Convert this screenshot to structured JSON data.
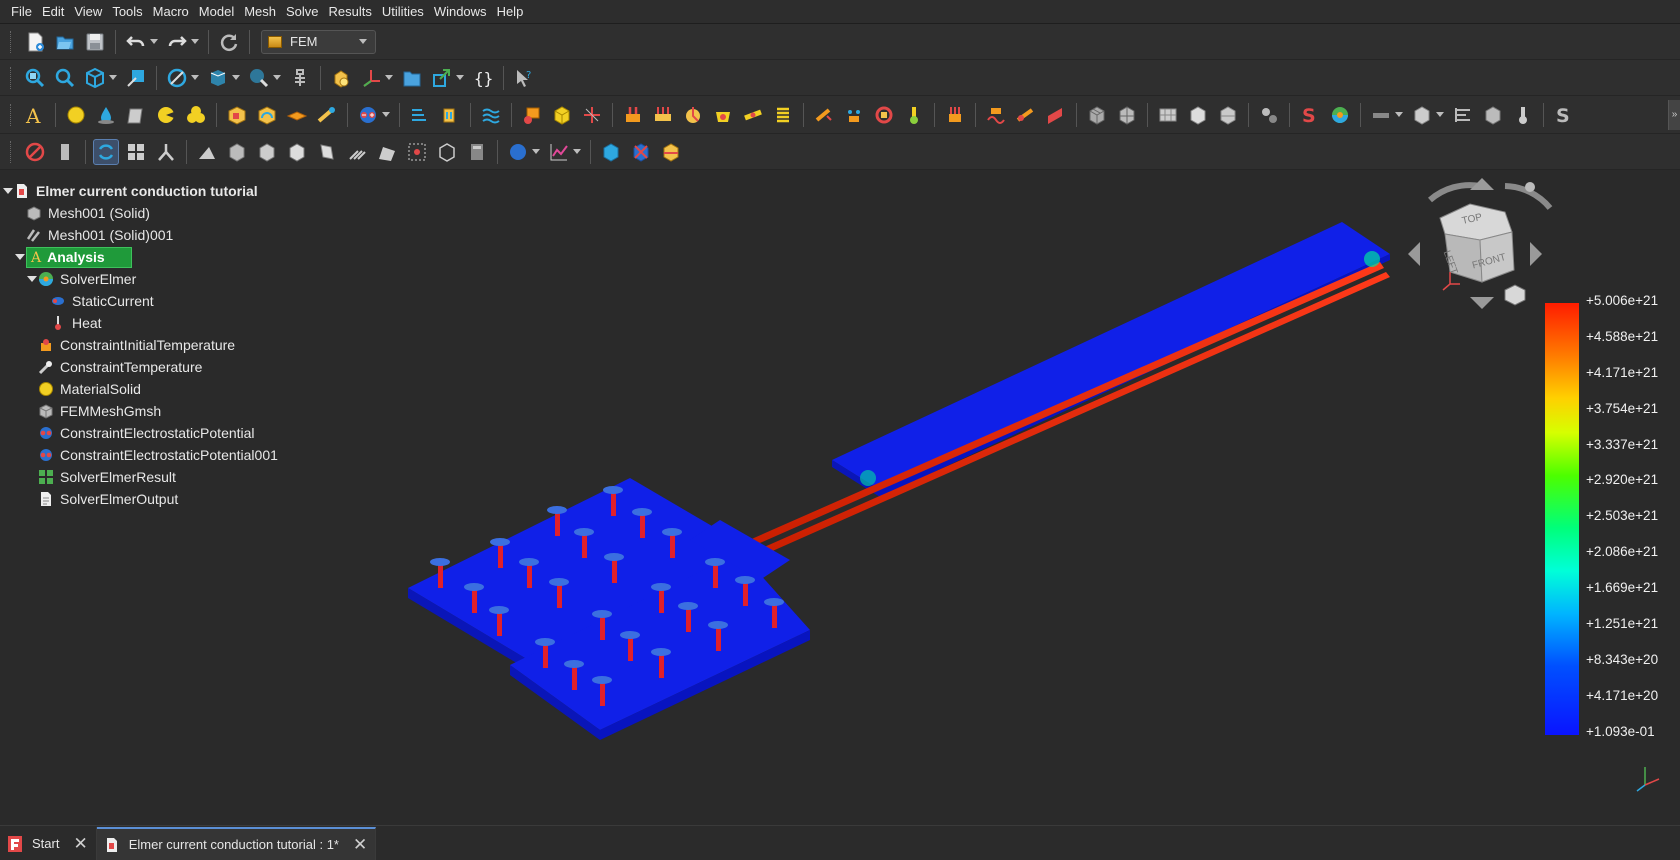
{
  "menu": [
    "File",
    "Edit",
    "View",
    "Tools",
    "Macro",
    "Model",
    "Mesh",
    "Solve",
    "Results",
    "Utilities",
    "Windows",
    "Help"
  ],
  "workbench": {
    "selected": "FEM"
  },
  "tree": {
    "root": "Elmer current conduction tutorial",
    "items": [
      {
        "label": "Mesh001 (Solid)",
        "level": 1,
        "icon": "mesh-solid-icon"
      },
      {
        "label": "Mesh001 (Solid)001",
        "level": 1,
        "icon": "mesh-solid-icon"
      },
      {
        "label": "Analysis",
        "level": 1,
        "icon": "analysis-icon"
      },
      {
        "label": "SolverElmer",
        "level": 2,
        "icon": "solver-elmer-icon"
      },
      {
        "label": "StaticCurrent",
        "level": 3,
        "icon": "equation-icon"
      },
      {
        "label": "Heat",
        "level": 3,
        "icon": "thermometer-icon"
      },
      {
        "label": "ConstraintInitialTemperature",
        "level": 2,
        "icon": "initial-temperature-icon"
      },
      {
        "label": "ConstraintTemperature",
        "level": 2,
        "icon": "temperature-constraint-icon"
      },
      {
        "label": "MaterialSolid",
        "level": 2,
        "icon": "material-icon"
      },
      {
        "label": "FEMMeshGmsh",
        "level": 2,
        "icon": "fem-mesh-icon"
      },
      {
        "label": "ConstraintElectrostaticPotential",
        "level": 2,
        "icon": "electrostatic-potential-icon"
      },
      {
        "label": "ConstraintElectrostaticPotential001",
        "level": 2,
        "icon": "electrostatic-potential-icon"
      },
      {
        "label": "SolverElmerResult",
        "level": 2,
        "icon": "result-grid-icon"
      },
      {
        "label": "SolverElmerOutput",
        "level": 2,
        "icon": "text-document-icon"
      }
    ]
  },
  "legend": {
    "labels": [
      "+5.006e+21",
      "+4.588e+21",
      "+4.171e+21",
      "+3.754e+21",
      "+3.337e+21",
      "+2.920e+21",
      "+2.503e+21",
      "+2.086e+21",
      "+1.669e+21",
      "+1.251e+21",
      "+8.343e+20",
      "+4.171e+20",
      "+1.093e-01"
    ]
  },
  "navcube": {
    "top": "TOP",
    "left": "LEFT",
    "front": "FRONT"
  },
  "tabs": [
    {
      "label": "Start",
      "close": "✕"
    },
    {
      "label": "Elmer current conduction tutorial : 1*",
      "close": "✕"
    }
  ],
  "colors": {
    "accent": "#1f9a3a",
    "high": "#ff2a00",
    "low": "#0a14ff"
  }
}
